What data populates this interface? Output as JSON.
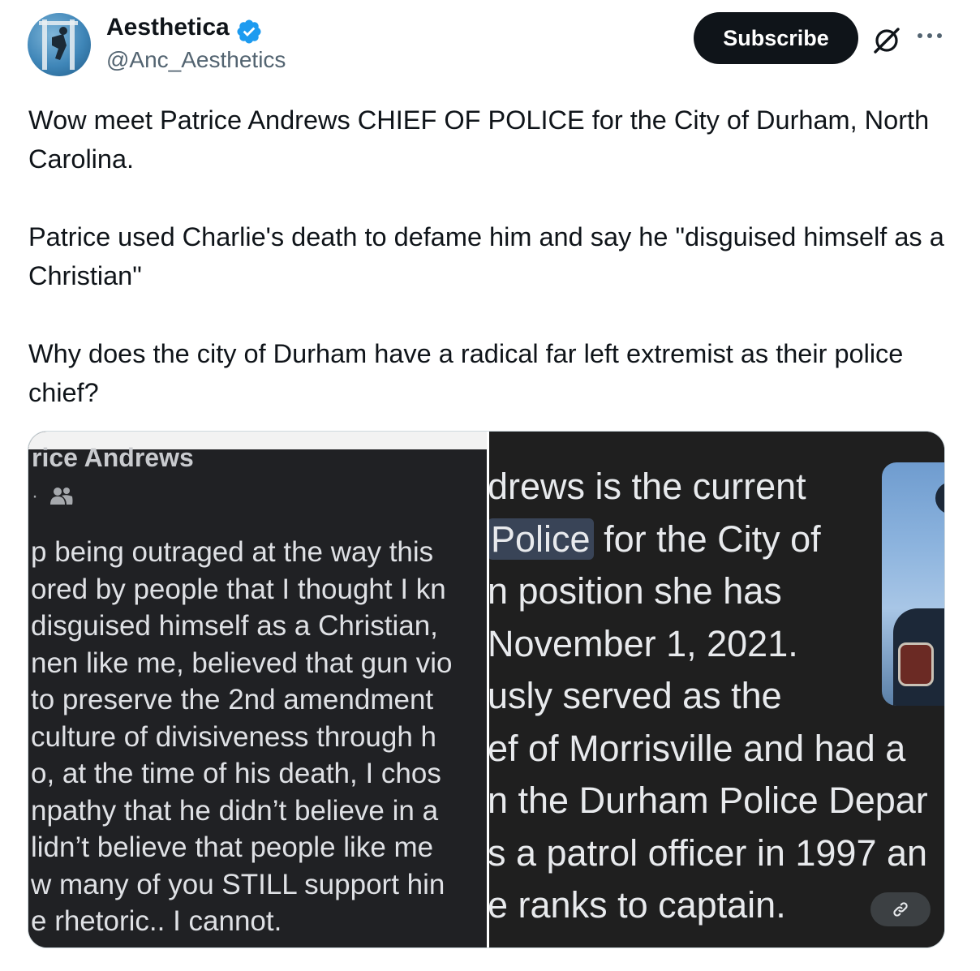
{
  "author": {
    "name": "Aesthetica",
    "handle": "@Anc_Aesthetics",
    "verified": true,
    "badge_color": "#1d9bf0"
  },
  "actions": {
    "subscribe_label": "Subscribe",
    "grok_icon": "grok-icon",
    "more_icon": "more-icon"
  },
  "tweet": {
    "paragraphs": [
      "Wow meet Patrice Andrews CHIEF OF POLICE for the City of Durham, North Carolina.",
      "Patrice used Charlie's death to defame him and say he \"disguised himself as a Christian\"",
      "Why does the city of Durham have a radical far left extremist as their police chief?"
    ]
  },
  "media": {
    "left_panel": {
      "name_partial": "rice Andrews",
      "meta": "·",
      "lines": [
        "p being outraged at the way this",
        "ored by people that I thought I kn",
        "disguised himself as a Christian,",
        "nen like me, believed that gun vio",
        " to preserve the 2nd amendment",
        "culture of divisiveness through h",
        "o, at the time of his death,  I chos",
        "npathy that he didn’t believe in a",
        "lidn’t believe that people like me",
        "w many of you STILL support hin",
        "e rhetoric..  I cannot."
      ]
    },
    "right_panel": {
      "lines": [
        {
          "pre": "drews is the current",
          "hl": "",
          "post": ""
        },
        {
          "pre": "",
          "hl": "Police",
          "post": " for the City of"
        },
        {
          "pre": "n position she has",
          "hl": "",
          "post": ""
        },
        {
          "pre": " November 1, 2021.",
          "hl": "",
          "post": ""
        },
        {
          "pre": "usly served as the",
          "hl": "",
          "post": ""
        },
        {
          "pre": "ef of Morrisville and had a",
          "hl": "",
          "post": ""
        },
        {
          "pre": "n the Durham Police Depar",
          "hl": "",
          "post": ""
        },
        {
          "pre": "s a patrol officer in 1997 an",
          "hl": "",
          "post": ""
        },
        {
          "pre": "e ranks to captain.",
          "hl": "",
          "post": ""
        }
      ],
      "link_icon": "link-icon"
    }
  }
}
